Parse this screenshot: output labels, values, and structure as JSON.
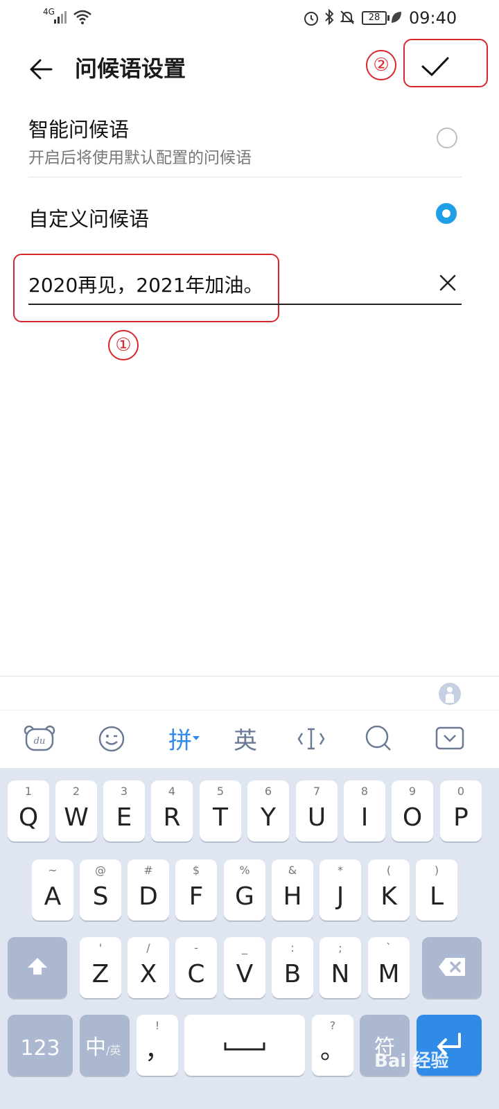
{
  "status": {
    "network": "4G",
    "battery": "28",
    "time": "09:40"
  },
  "header": {
    "title": "问候语设置"
  },
  "options": [
    {
      "title": "智能问候语",
      "subtitle": "开启后将使用默认配置的问候语",
      "selected": false
    },
    {
      "title": "自定义问候语",
      "subtitle": "",
      "selected": true
    }
  ],
  "input": {
    "value": "2020再见，2021年加油。"
  },
  "annotations": {
    "one": "①",
    "two": "②"
  },
  "toolbar": {
    "pinyin": "拼",
    "english": "英"
  },
  "keyboard": {
    "row1": [
      {
        "main": "Q",
        "sub": "1"
      },
      {
        "main": "W",
        "sub": "2"
      },
      {
        "main": "E",
        "sub": "3"
      },
      {
        "main": "R",
        "sub": "4"
      },
      {
        "main": "T",
        "sub": "5"
      },
      {
        "main": "Y",
        "sub": "6"
      },
      {
        "main": "U",
        "sub": "7"
      },
      {
        "main": "I",
        "sub": "8"
      },
      {
        "main": "O",
        "sub": "9"
      },
      {
        "main": "P",
        "sub": "0"
      }
    ],
    "row2": [
      {
        "main": "A",
        "sub": "~"
      },
      {
        "main": "S",
        "sub": "@"
      },
      {
        "main": "D",
        "sub": "#"
      },
      {
        "main": "F",
        "sub": "$"
      },
      {
        "main": "G",
        "sub": "%"
      },
      {
        "main": "H",
        "sub": "&"
      },
      {
        "main": "J",
        "sub": "*"
      },
      {
        "main": "K",
        "sub": "("
      },
      {
        "main": "L",
        "sub": ")"
      }
    ],
    "row3": [
      {
        "main": "Z",
        "sub": "'"
      },
      {
        "main": "X",
        "sub": "/"
      },
      {
        "main": "C",
        "sub": "-"
      },
      {
        "main": "V",
        "sub": "_"
      },
      {
        "main": "B",
        "sub": ":"
      },
      {
        "main": "N",
        "sub": ";"
      },
      {
        "main": "M",
        "sub": "`"
      }
    ],
    "num_label": "123",
    "lang_label": "中",
    "lang_sub": "/英",
    "comma": {
      "main": "，",
      "sub": "!"
    },
    "period": {
      "main": "。",
      "sub": "?"
    },
    "symbol_label": "符"
  },
  "watermark": "Bai 经验"
}
